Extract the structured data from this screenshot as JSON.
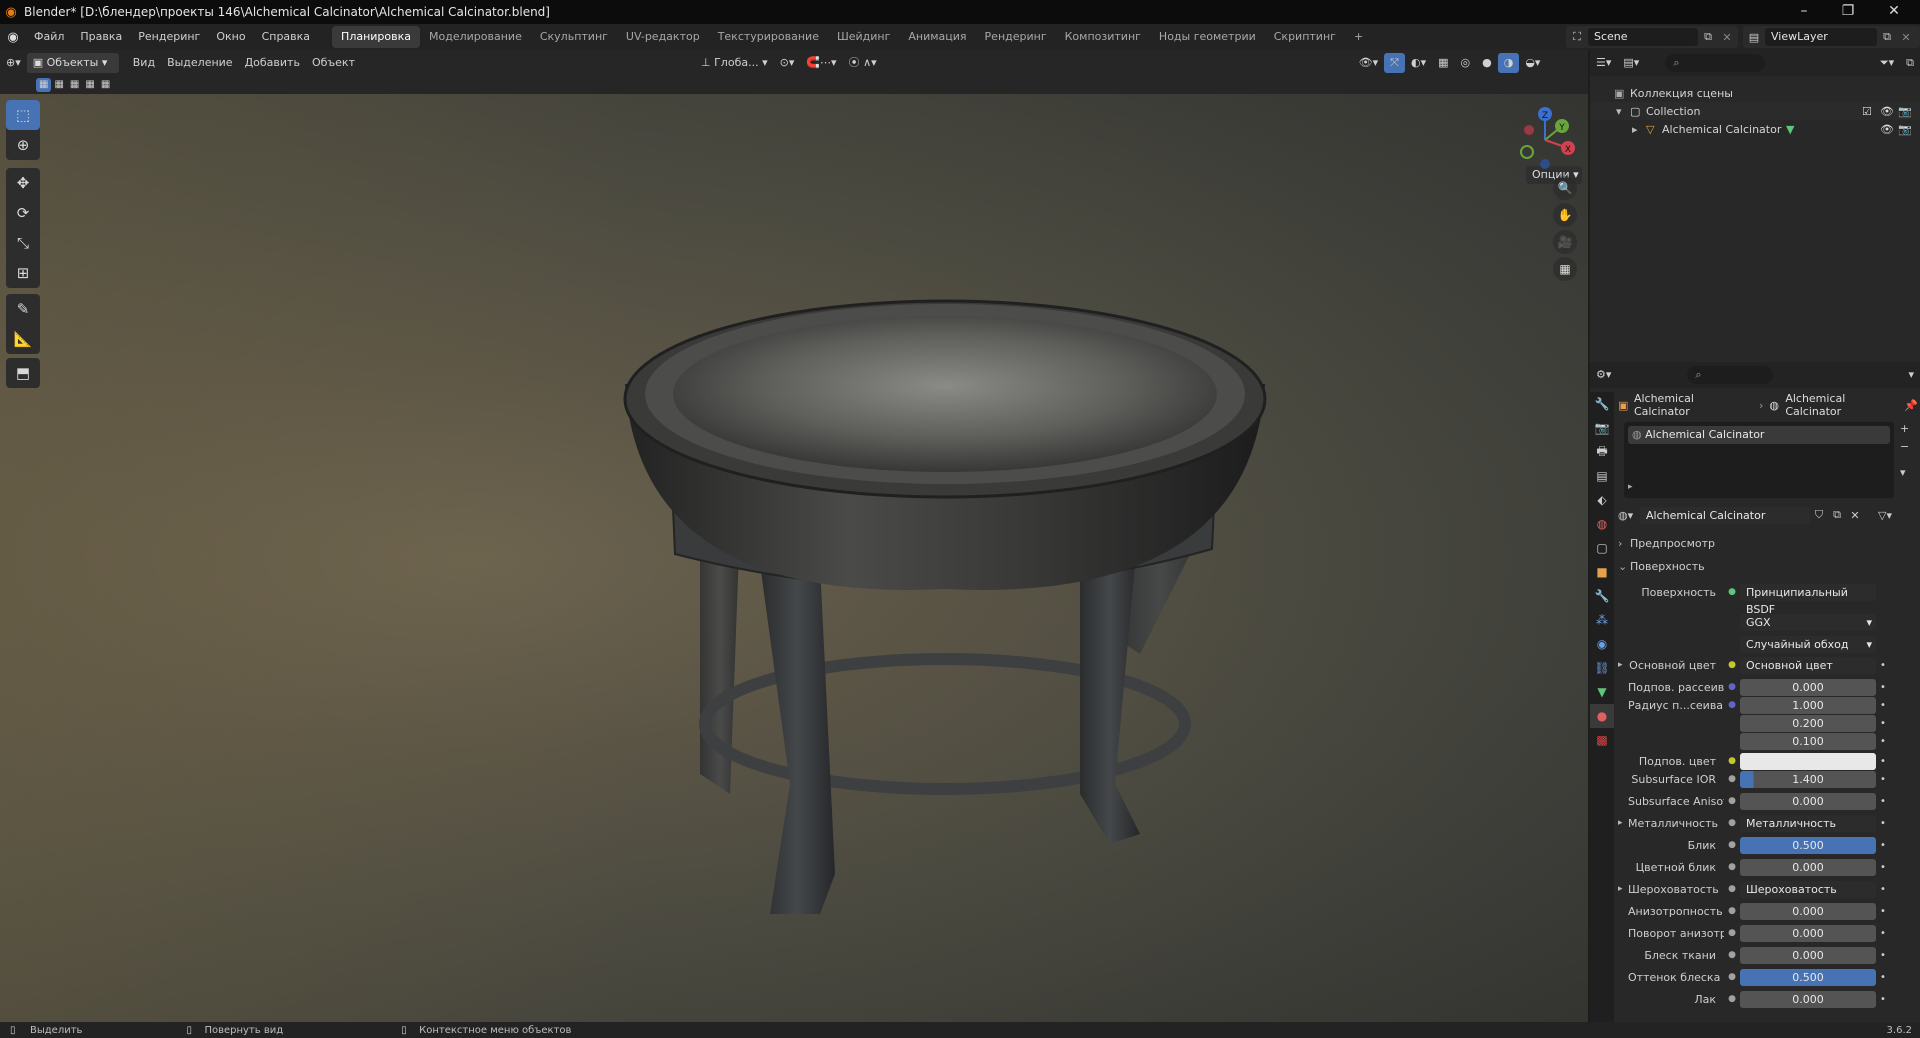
{
  "window": {
    "title": "Blender* [D:\\блендер\\проекты 146\\Alchemical Calcinator\\Alchemical Calcinator.blend]",
    "controls": [
      "–",
      "❐",
      "✕"
    ]
  },
  "menu": [
    "Файл",
    "Правка",
    "Рендеринг",
    "Окно",
    "Справка"
  ],
  "workspaces": [
    "Планировка",
    "Моделирование",
    "Скульптинг",
    "UV-редактор",
    "Текстурирование",
    "Шейдинг",
    "Анимация",
    "Рендеринг",
    "Композитинг",
    "Ноды геометрии",
    "Скриптинг"
  ],
  "active_workspace": "Планировка",
  "add_workspace": "+",
  "scene": "Scene",
  "viewlayer": "ViewLayer",
  "viewport_header": {
    "mode": "Объекты",
    "menus": [
      "Вид",
      "Выделение",
      "Добавить",
      "Объект"
    ],
    "transform_orientation": "Глоба...",
    "options": "Опции"
  },
  "gizmo": {
    "z": "Z",
    "y": "Y",
    "x": "X"
  },
  "outliner": {
    "root": "Коллекция сцены",
    "items": [
      {
        "label": "Collection",
        "depth": 1
      },
      {
        "label": "Alchemical Calcinator",
        "depth": 2
      }
    ]
  },
  "properties": {
    "breadcrumb_object": "Alchemical Calcinator",
    "breadcrumb_material": "Alchemical Calcinator",
    "slot": "Alchemical Calcinator",
    "material_name": "Alchemical Calcinator",
    "panels": {
      "preview": "Предпросмотр",
      "surface": "Поверхность"
    },
    "surface_label": "Поверхность",
    "surface_value": "Принципиальный BSDF",
    "distribution": "GGX",
    "subsurface_method": "Случайный обход",
    "rows": [
      {
        "label": "Основной цвет",
        "value": "Основной цвет",
        "kind": "link",
        "dot": "#c7c729"
      },
      {
        "label": "Подпов. рассеива...",
        "value": "0.000",
        "kind": "num",
        "dot": "#6363c7"
      },
      {
        "label": "Радиус п...сеивания",
        "value": "1.000",
        "kind": "num",
        "dot": "#6363c7"
      },
      {
        "label": "",
        "value": "0.200",
        "kind": "num",
        "dot": ""
      },
      {
        "label": "",
        "value": "0.100",
        "kind": "num",
        "dot": ""
      },
      {
        "label": "Подпов. цвет",
        "value": "",
        "kind": "color",
        "dot": "#c7c729"
      },
      {
        "label": "Subsurface IOR",
        "value": "1.400",
        "kind": "num",
        "dot": "#a1a1a1",
        "fill": 0.1
      },
      {
        "label": "Subsurface Anisotr...",
        "value": "0.000",
        "kind": "num",
        "dot": "#a1a1a1"
      },
      {
        "label": "Металличность",
        "value": "Металличность",
        "kind": "link",
        "dot": "#a1a1a1"
      },
      {
        "label": "Блик",
        "value": "0.500",
        "kind": "blue",
        "dot": "#a1a1a1"
      },
      {
        "label": "Цветной блик",
        "value": "0.000",
        "kind": "num",
        "dot": "#a1a1a1"
      },
      {
        "label": "Шероховатость",
        "value": "Шероховатость",
        "kind": "link",
        "dot": "#a1a1a1"
      },
      {
        "label": "Анизотропность",
        "value": "0.000",
        "kind": "num",
        "dot": "#a1a1a1"
      },
      {
        "label": "Поворот анизотро...",
        "value": "0.000",
        "kind": "num",
        "dot": "#a1a1a1"
      },
      {
        "label": "Блеск ткани",
        "value": "0.000",
        "kind": "num",
        "dot": "#a1a1a1"
      },
      {
        "label": "Оттенок блеска тк...",
        "value": "0.500",
        "kind": "blue",
        "dot": "#a1a1a1"
      },
      {
        "label": "Лак",
        "value": "0.000",
        "kind": "num",
        "dot": "#a1a1a1"
      }
    ]
  },
  "status": {
    "select": "Выделить",
    "rotate": "Повернуть вид",
    "context": "Контекстное меню объектов",
    "version": "3.6.2"
  }
}
